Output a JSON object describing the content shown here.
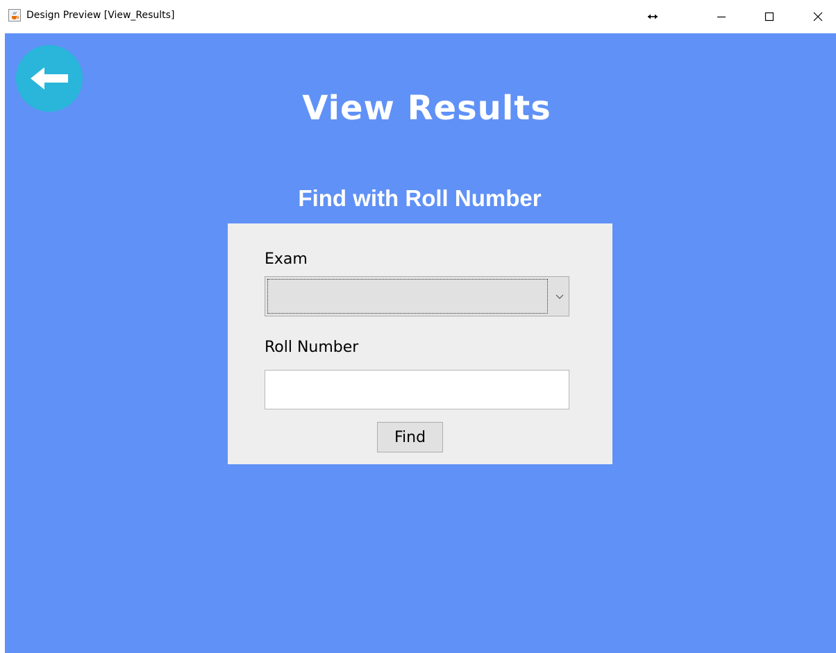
{
  "window": {
    "title": "Design Preview [View_Results]",
    "icons": {
      "app": "java-cup-icon",
      "resize": "horizontal-resize-icon",
      "minimize": "minimize-icon",
      "maximize": "maximize-icon",
      "close": "close-icon"
    }
  },
  "colors": {
    "background": "#6091f6",
    "back_button": "#29b6da",
    "panel": "#eeeeee",
    "text_light": "#ffffff"
  },
  "header": {
    "back_icon": "arrow-left-icon",
    "title": "View Results",
    "subtitle": "Find with Roll Number"
  },
  "form": {
    "exam_label": "Exam",
    "exam_selected": "",
    "roll_label": "Roll Number",
    "roll_value": "",
    "find_label": "Find"
  }
}
